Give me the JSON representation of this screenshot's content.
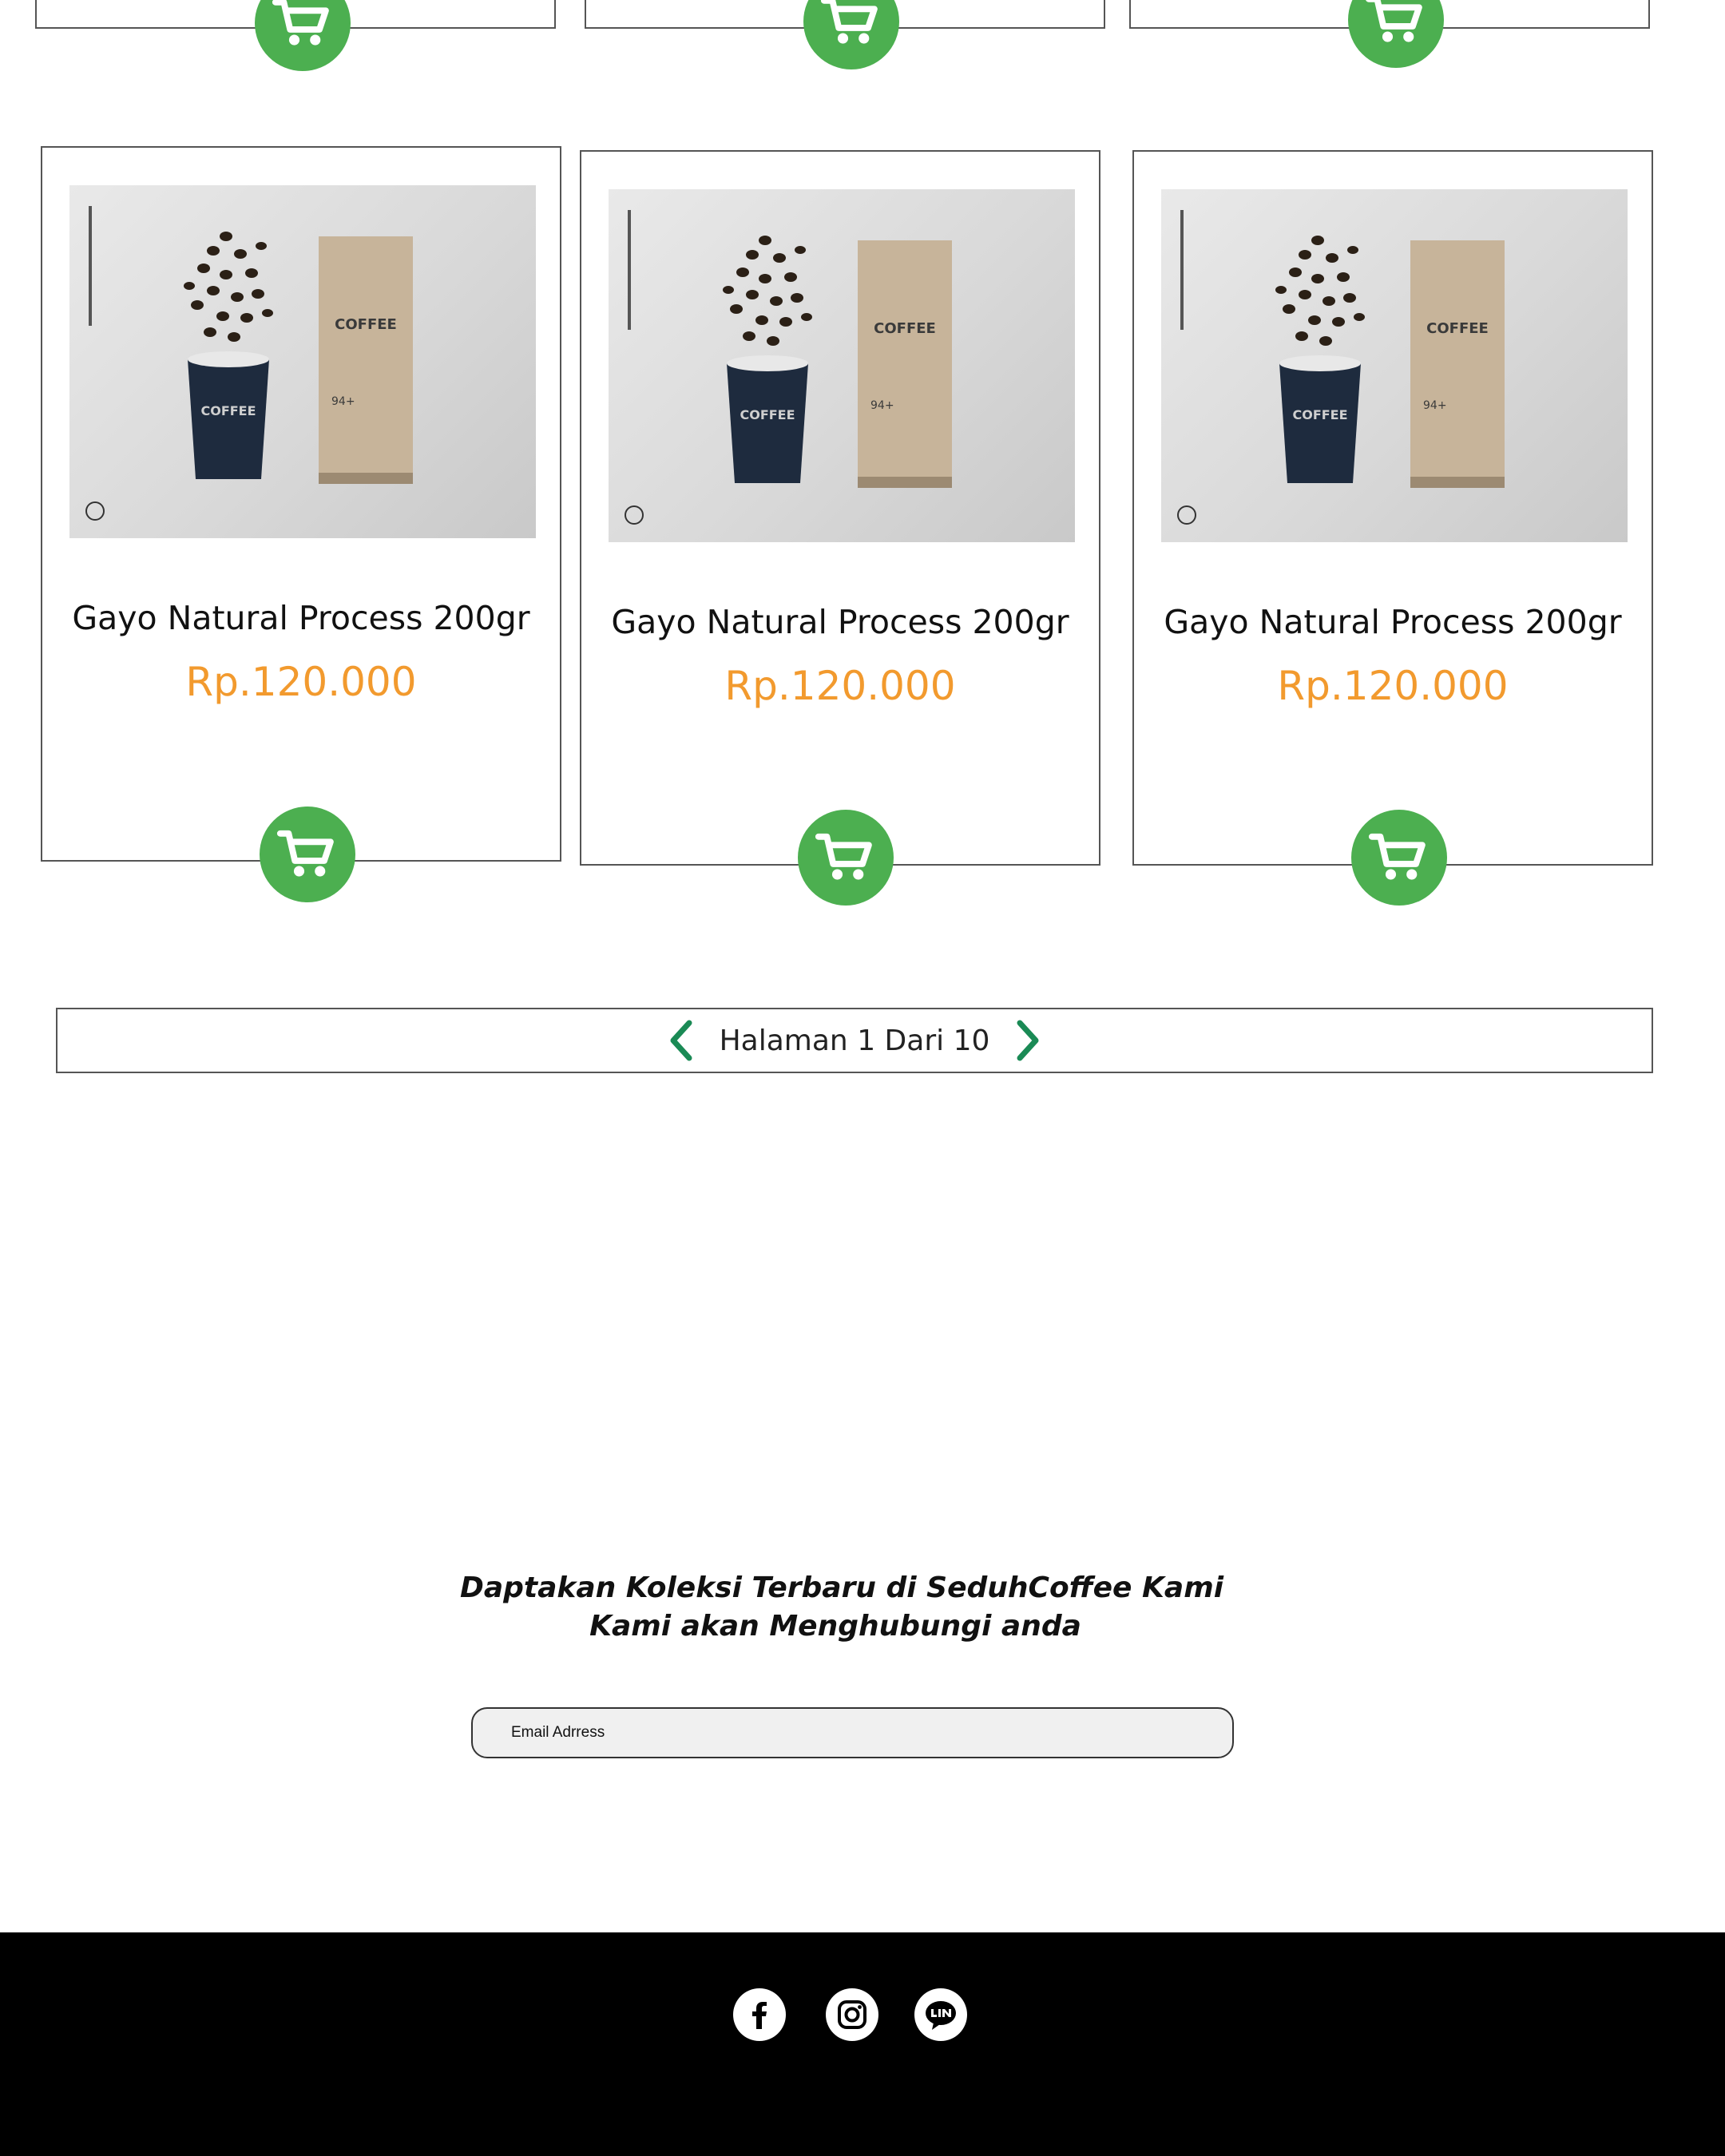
{
  "products_top_row": [
    {
      "cart_label": "add to cart"
    },
    {
      "cart_label": "add to cart"
    },
    {
      "cart_label": "add to cart"
    }
  ],
  "products": [
    {
      "name": "Gayo Natural Process 200gr",
      "price": "Rp.120.000",
      "bag_label": "COFFEE",
      "cup_label": "COFFEE",
      "bag_number": "94+"
    },
    {
      "name": "Gayo Natural Process 200gr",
      "price": "Rp.120.000",
      "bag_label": "COFFEE",
      "cup_label": "COFFEE",
      "bag_number": "94+"
    },
    {
      "name": "Gayo Natural Process 200gr",
      "price": "Rp.120.000",
      "bag_label": "COFFEE",
      "cup_label": "COFFEE",
      "bag_number": "94+"
    }
  ],
  "pagination": {
    "text": "Halaman 1 Dari 10",
    "prev_icon": "chevron-left-icon",
    "next_icon": "chevron-right-icon"
  },
  "newsletter": {
    "line1": "Daptakan Koleksi Terbaru  di SeduhCoffee Kami",
    "line2": "Kami akan Menghubungi anda",
    "email_placeholder": "Email Adrress"
  },
  "footer": {
    "social_icons": [
      "facebook-icon",
      "instagram-icon",
      "line-icon"
    ]
  },
  "colors": {
    "accent_green": "#4caf50",
    "price_orange": "#f29a2e",
    "chevron_green": "#1a8a55",
    "footer_bg": "#000000"
  }
}
